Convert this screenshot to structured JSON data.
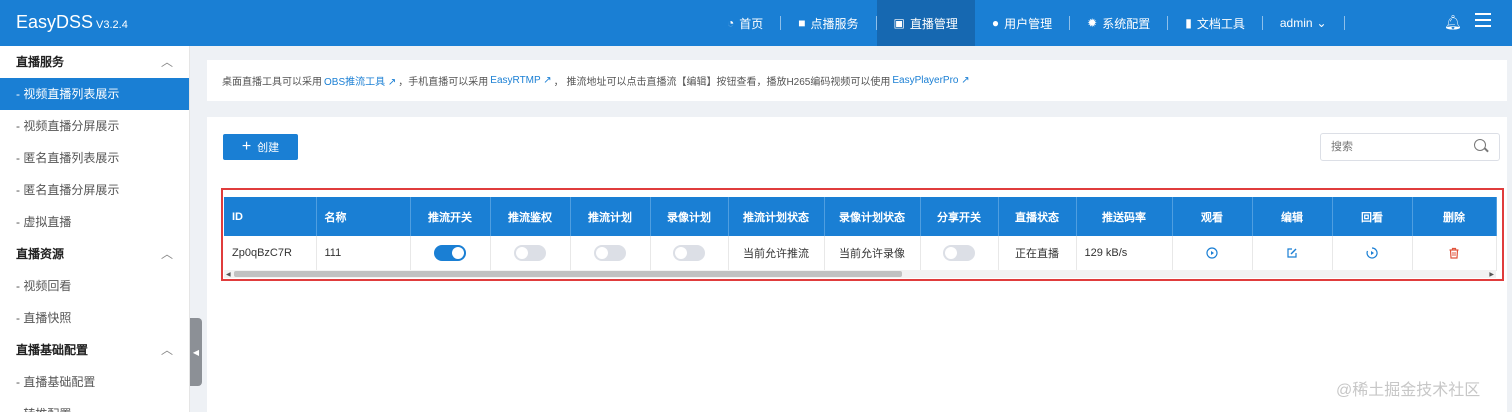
{
  "app": {
    "name": "EasyDSS",
    "version": "V3.2.4"
  },
  "nav": [
    {
      "label": "首页",
      "icon": "dashboard-icon",
      "active": false
    },
    {
      "label": "点播服务",
      "icon": "video-icon",
      "active": false
    },
    {
      "label": "直播管理",
      "icon": "live-icon",
      "active": true
    },
    {
      "label": "用户管理",
      "icon": "user-icon",
      "active": false
    },
    {
      "label": "系统配置",
      "icon": "gear-icon",
      "active": false
    },
    {
      "label": "文档工具",
      "icon": "book-icon",
      "active": false
    }
  ],
  "user": {
    "name": "admin"
  },
  "sidebar": {
    "sections": [
      {
        "title": "直播服务",
        "items": [
          "- 视频直播列表展示",
          "- 视频直播分屏展示",
          "- 匿名直播列表展示",
          "- 匿名直播分屏展示",
          "- 虚拟直播"
        ]
      },
      {
        "title": "直播资源",
        "items": [
          "- 视频回看",
          "- 直播快照"
        ]
      },
      {
        "title": "直播基础配置",
        "items": [
          "- 直播基础配置",
          "- 转推配置"
        ]
      }
    ],
    "active_item": "- 视频直播列表展示"
  },
  "tip": {
    "t1": "桌面直播工具可以采用",
    "l1": "OBS推流工具",
    "t2": "，手机直播可以采用",
    "l2": "EasyRTMP",
    "t3": "， 推流地址可以点击直播流【编辑】按钮查看，播放H265编码视频可以使用",
    "l3": "EasyPlayerPro"
  },
  "toolbar": {
    "create_label": "创建",
    "search_placeholder": "搜索"
  },
  "table": {
    "columns": [
      "ID",
      "名称",
      "推流开关",
      "推流鉴权",
      "推流计划",
      "录像计划",
      "推流计划状态",
      "录像计划状态",
      "分享开关",
      "直播状态",
      "推送码率",
      "观看",
      "编辑",
      "回看",
      "删除"
    ],
    "rows": [
      {
        "id": "Zp0qBzC7R",
        "name": "111",
        "push_switch": true,
        "push_auth": false,
        "push_plan": false,
        "record_plan": false,
        "push_plan_status": "当前允许推流",
        "record_plan_status": "当前允许录像",
        "share_switch": false,
        "live_status": "正在直播",
        "bitrate": "129 kB/s"
      }
    ]
  },
  "watermark": "@稀土掘金技术社区",
  "colors": {
    "primary": "#1a7fd4",
    "highlight": "#e03c3c",
    "delete": "#e0543c"
  }
}
